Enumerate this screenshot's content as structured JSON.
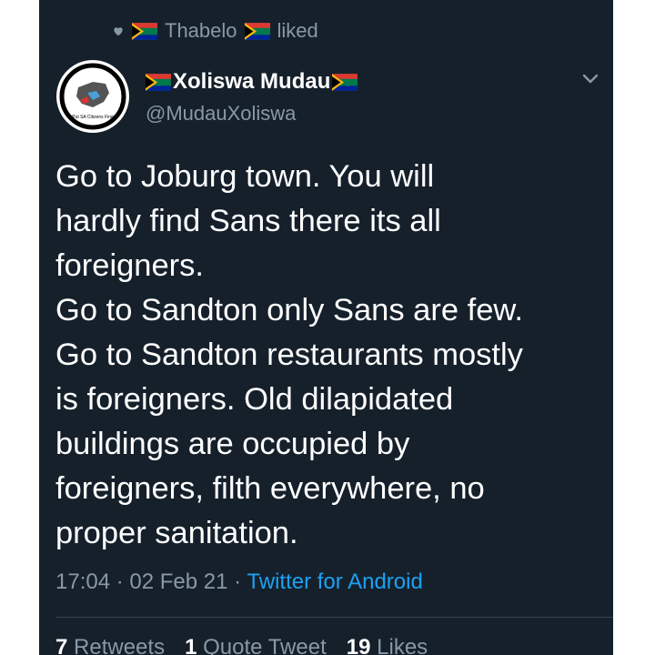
{
  "social_context": {
    "icon": "heart-icon",
    "user_name": "Thabelo",
    "action": "liked"
  },
  "author": {
    "display_name": "Xoliswa Mudau",
    "handle": "@MudauXoliswa",
    "avatar_text": "Put SA Citizens First",
    "flag_emoji_icon": "south-africa-flag-icon"
  },
  "tweet": {
    "text": "Go to Joburg town. You will\nhardly find Sans there its all\nforeigners.\nGo to Sandton only Sans are few.\nGo to Sandton restaurants mostly\nis foreigners. Old dilapidated\nbuildings are occupied by\nforeigners, filth everywhere, no\nproper sanitation.",
    "time": "17:04",
    "date": "02 Feb 21",
    "source": "Twitter for Android"
  },
  "stats": {
    "retweets_count": "7",
    "retweets_label": "Retweets",
    "quote_count": "1",
    "quote_label": "Quote Tweet",
    "likes_count": "19",
    "likes_label": "Likes"
  },
  "colors": {
    "background": "#15202b",
    "secondary_text": "#8899a6",
    "link": "#1da1f2"
  }
}
